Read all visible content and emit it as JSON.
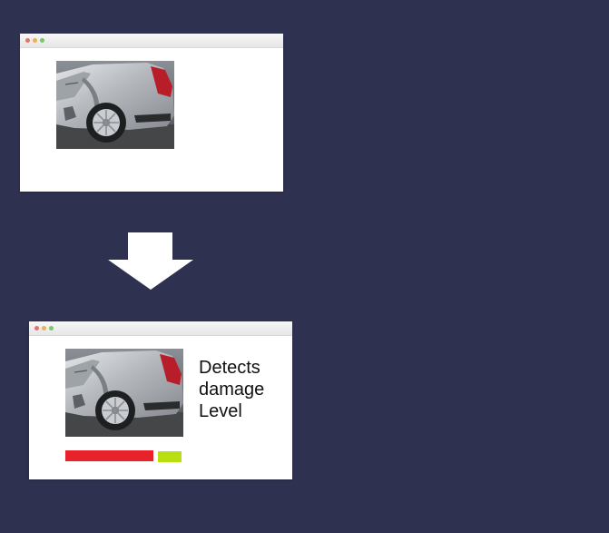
{
  "windows": {
    "input": {
      "title_dots": [
        "#e0746c",
        "#e8b25a",
        "#7bc56a"
      ]
    },
    "output": {
      "title_dots": [
        "#e0746c",
        "#e8b25a",
        "#7bc56a"
      ]
    }
  },
  "arrow": {
    "color": "#ffffff",
    "direction": "down"
  },
  "result": {
    "caption_lines": [
      "Detects",
      "damage",
      "Level"
    ]
  },
  "damage_indicator": {
    "segments": [
      {
        "name": "damage",
        "color": "#e8222a"
      },
      {
        "name": "intact",
        "color": "#b9df12"
      }
    ]
  },
  "images": {
    "subject": "damaged-silver-car-rear-quarter",
    "car_color": "#b8bcc2"
  }
}
